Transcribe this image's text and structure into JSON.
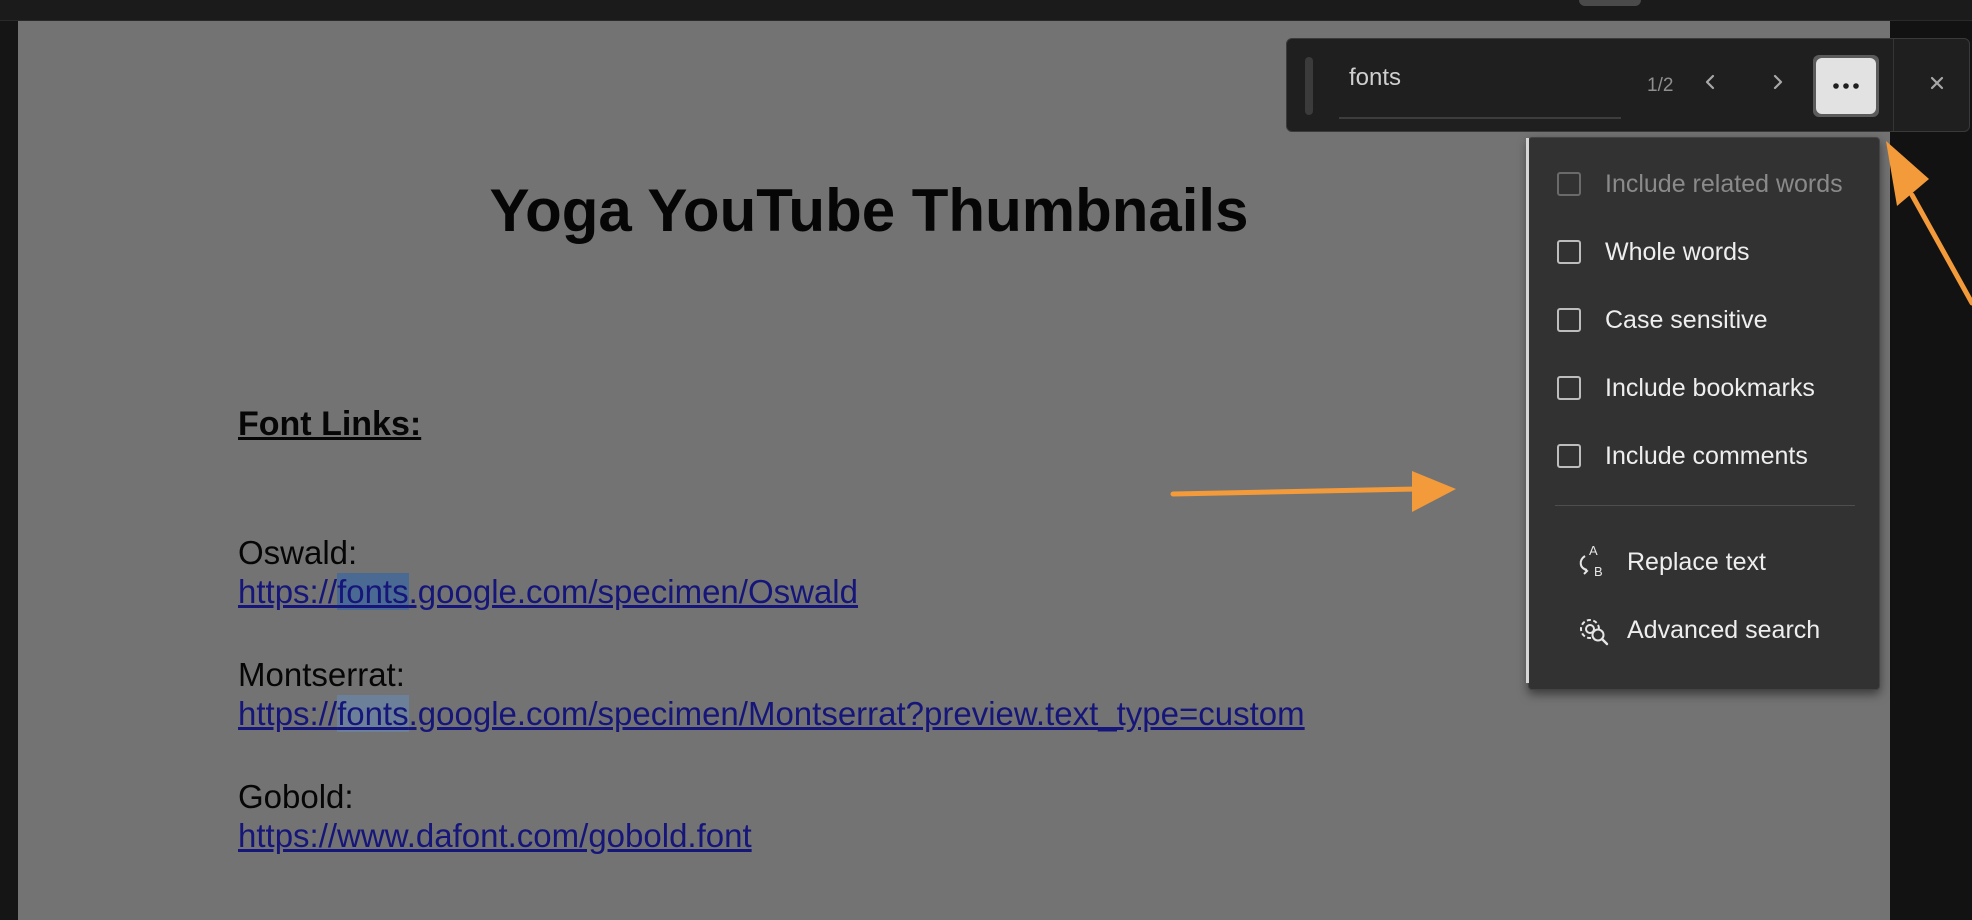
{
  "document": {
    "title": "Yoga YouTube Thumbnails",
    "section_heading": "Font Links:",
    "entries": [
      {
        "name": "Oswald:",
        "link_prefix": "https://",
        "link_match": "fonts",
        "link_suffix": ".google.com/specimen/Oswald"
      },
      {
        "name": "Montserrat:",
        "link_prefix": "https://",
        "link_match": "fonts",
        "link_suffix": ".google.com/specimen/Montserrat?preview.text_type=custom"
      },
      {
        "name": "Gobold:",
        "link": "https://www.dafont.com/gobold.font"
      }
    ]
  },
  "find_bar": {
    "query": "fonts",
    "count": "1/2",
    "icons": {
      "prev": "chevron-left-icon",
      "next": "chevron-right-icon",
      "more": "more-options-icon",
      "close": "close-icon"
    }
  },
  "find_options": {
    "options": [
      {
        "label": "Include related words",
        "checked": false,
        "enabled": false
      },
      {
        "label": "Whole words",
        "checked": false,
        "enabled": true
      },
      {
        "label": "Case sensitive",
        "checked": false,
        "enabled": true
      },
      {
        "label": "Include bookmarks",
        "checked": false,
        "enabled": true
      },
      {
        "label": "Include comments",
        "checked": false,
        "enabled": true
      }
    ],
    "actions": [
      {
        "label": "Replace text",
        "icon": "replace-text-icon"
      },
      {
        "label": "Advanced search",
        "icon": "advanced-search-icon"
      }
    ]
  },
  "colors": {
    "page_background": "#737373",
    "link": "#16167a",
    "search_highlight": "#4a6a93",
    "panel": "#323232",
    "annotation_arrow": "#f39a3b"
  }
}
